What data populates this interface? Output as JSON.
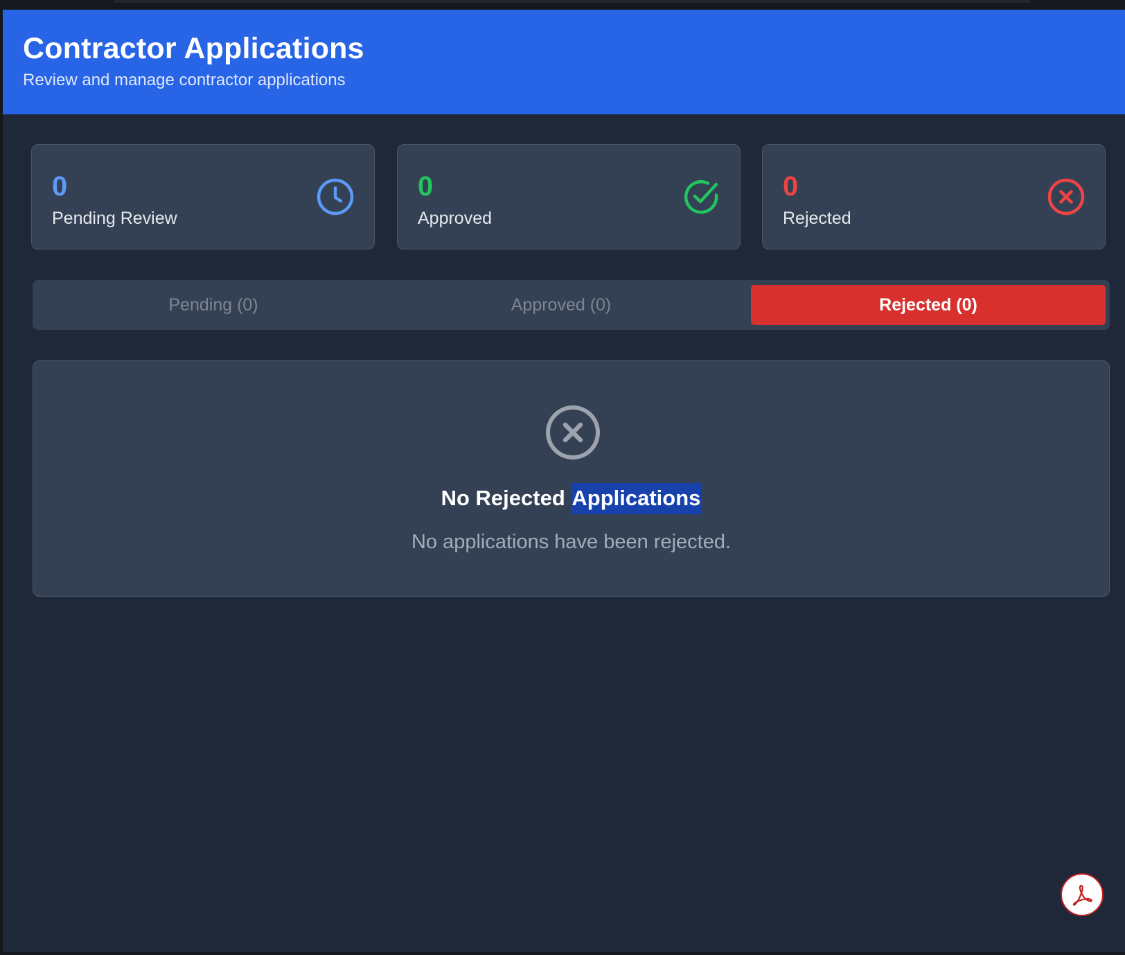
{
  "header": {
    "title": "Contractor Applications",
    "subtitle": "Review and manage contractor applications"
  },
  "stats": [
    {
      "value": "0",
      "label": "Pending Review",
      "icon": "clock-icon",
      "color": "#5b9af5"
    },
    {
      "value": "0",
      "label": "Approved",
      "icon": "check-circle-icon",
      "color": "#22c55e"
    },
    {
      "value": "0",
      "label": "Rejected",
      "icon": "x-circle-icon",
      "color": "#ef4444"
    }
  ],
  "tabs": [
    {
      "label": "Pending (0)",
      "active": false
    },
    {
      "label": "Approved (0)",
      "active": false
    },
    {
      "label": "Rejected (0)",
      "active": true
    }
  ],
  "empty_state": {
    "icon": "x-circle-icon",
    "title_prefix": "No Rejected",
    "title_highlight": "Applications",
    "description": "No applications have been rejected."
  },
  "fab": {
    "icon": "pdf-icon"
  },
  "colors": {
    "header": "#2764e6",
    "background": "#1f2839",
    "card": "#344054",
    "active_tab": "#d8302d"
  }
}
